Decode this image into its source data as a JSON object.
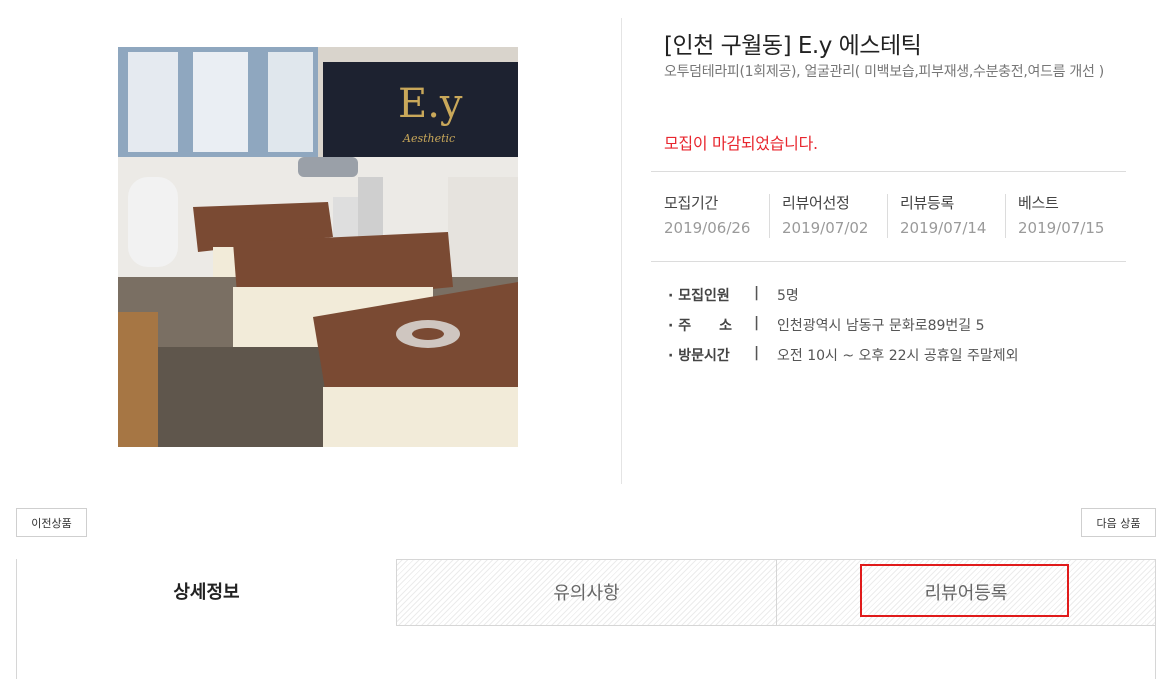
{
  "product": {
    "title": "[인천 구월동] E.y 에스테틱",
    "subtitle": "오투덤테라피(1회제공), 얼굴관리( 미백보습,피부재생,수분충전,여드름 개선 )",
    "status": "모집이 마감되었습니다.",
    "photo_sign": "E.y",
    "photo_sign_script": "Aesthetic"
  },
  "schedule": [
    {
      "label": "모집기간",
      "date": "2019/06/26"
    },
    {
      "label": "리뷰어선정",
      "date": "2019/07/02"
    },
    {
      "label": "리뷰등록",
      "date": "2019/07/14"
    },
    {
      "label": "베스트",
      "date": "2019/07/15"
    }
  ],
  "info": [
    {
      "key": "· 모집인원",
      "sep": "|",
      "value": "5명"
    },
    {
      "key": "· 주　　소",
      "sep": "|",
      "value": "인천광역시 남동구 문화로89번길 5"
    },
    {
      "key": "· 방문시간",
      "sep": "|",
      "value": "오전 10시 ~ 오후 22시 공휴일 주말제외"
    }
  ],
  "nav": {
    "prev_label": "이전상품",
    "next_label": "다음 상품"
  },
  "tabs": [
    {
      "label": "상세정보",
      "active": true
    },
    {
      "label": "유의사항",
      "active": false
    },
    {
      "label": "리뷰어등록",
      "active": false
    }
  ],
  "colors": {
    "status_red": "#e8262e",
    "highlight_red": "#e01b1b",
    "towel_brown": "#7a4a33"
  }
}
